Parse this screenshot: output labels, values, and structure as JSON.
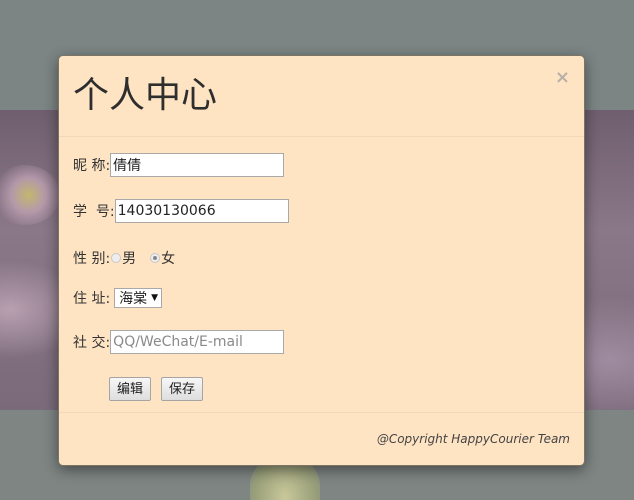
{
  "modal": {
    "title": "个人中心",
    "close_symbol": "×"
  },
  "form": {
    "nickname": {
      "label": "昵 称:",
      "value": "倩倩"
    },
    "student_id": {
      "label": "学  号:",
      "value": "14030130066"
    },
    "gender": {
      "label": "性 别:",
      "options": [
        "男",
        "女"
      ],
      "selected": "女"
    },
    "address": {
      "label": "住 址:",
      "selected": "海棠"
    },
    "social": {
      "label": "社 交:",
      "value": "",
      "placeholder": "QQ/WeChat/E-mail"
    },
    "edit_button": "编辑",
    "save_button": "保存"
  },
  "footer": {
    "copyright": "@Copyright HappyCourier Team"
  },
  "icons": {
    "close": "close-icon",
    "dropdown": "chevron-down-icon"
  },
  "colors": {
    "modal_background": "#ffe4c4",
    "overlay": "#7f8786"
  }
}
